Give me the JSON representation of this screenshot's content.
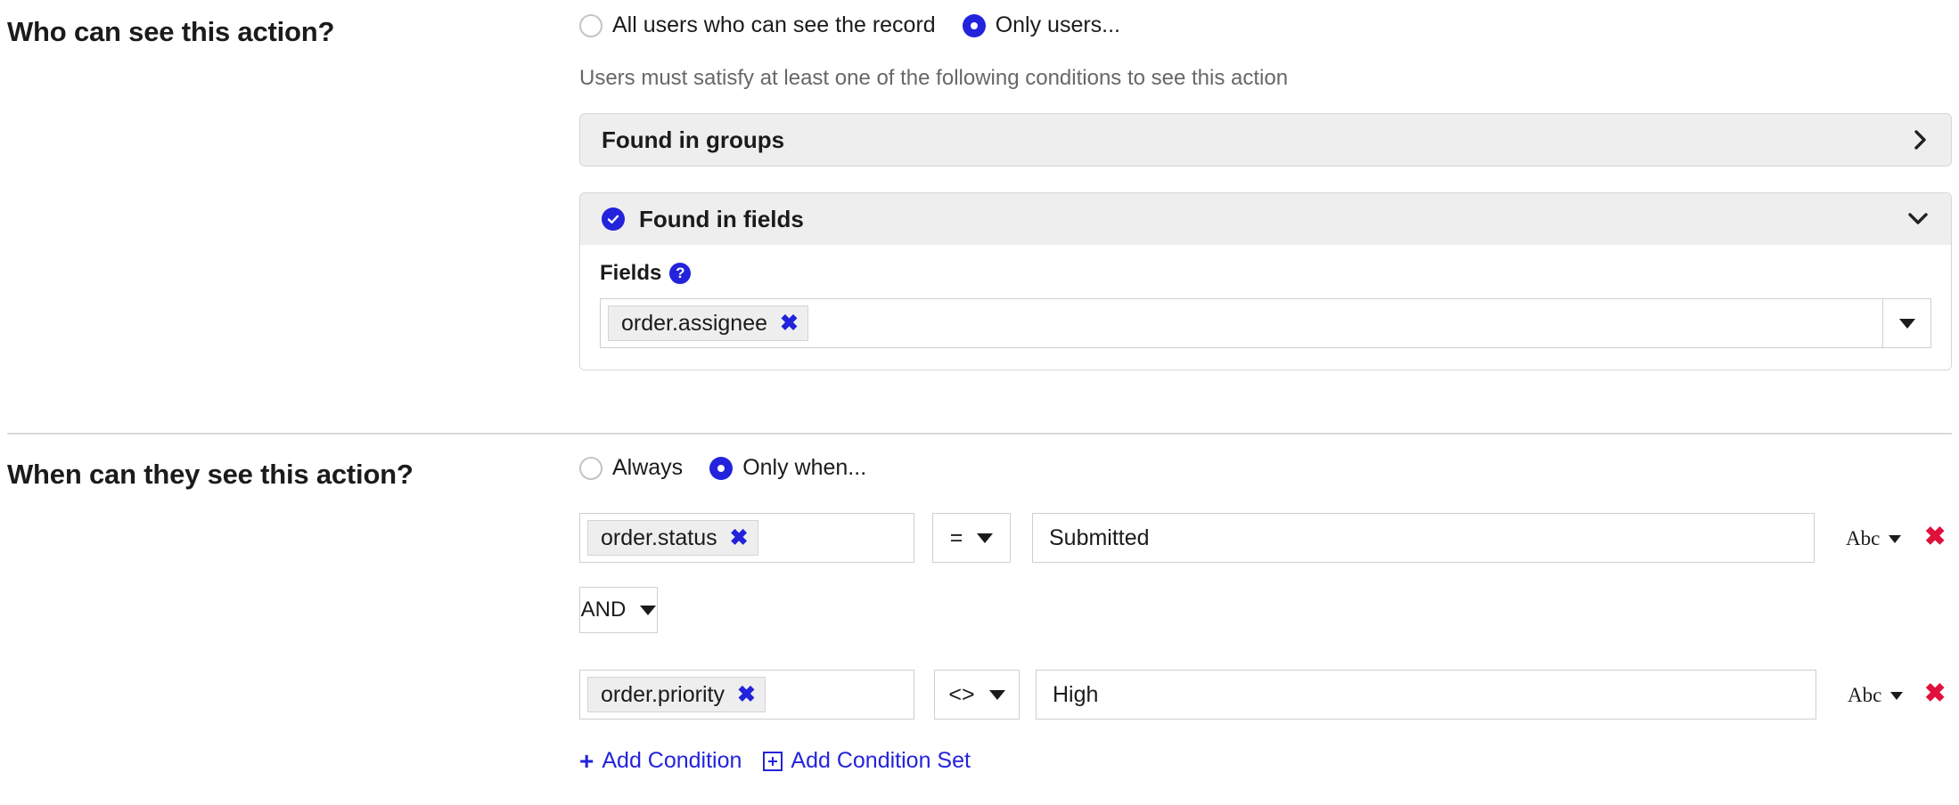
{
  "visibility_section": {
    "title": "Who can see this action?",
    "radios": [
      {
        "label": "All users who can see the record",
        "selected": false
      },
      {
        "label": "Only users...",
        "selected": true
      }
    ],
    "helper_text": "Users must satisfy at least one of the following conditions to see this action",
    "panels": [
      {
        "title": "Found in groups",
        "expanded": false,
        "checked": false,
        "chevron": "chevron-right-icon"
      },
      {
        "title": "Found in fields",
        "expanded": true,
        "checked": true,
        "chevron": "chevron-down-icon"
      }
    ],
    "fields_block": {
      "label": "Fields",
      "help_icon": "help-circle-icon",
      "tokens": [
        {
          "text": "order.assignee",
          "remove": "✖"
        }
      ],
      "dropdown_icon": "caret-down-icon"
    }
  },
  "timing_section": {
    "title": "When can they see this action?",
    "radios": [
      {
        "label": "Always",
        "selected": false
      },
      {
        "label": "Only when...",
        "selected": true
      }
    ],
    "conditions": [
      {
        "field": "order.status",
        "field_remove": "✖",
        "operator": "=",
        "value": "Submitted",
        "type_label": "Abc",
        "delete": "✖"
      },
      {
        "field": "order.priority",
        "field_remove": "✖",
        "operator": "<>",
        "value": "High",
        "type_label": "Abc",
        "delete": "✖"
      }
    ],
    "logic_operator": "AND",
    "add_condition": {
      "icon": "plus-icon",
      "label": "Add Condition"
    },
    "add_condition_set": {
      "icon": "box-plus-icon",
      "label": "Add Condition Set"
    }
  },
  "colors": {
    "accent_blue": "#2323dc",
    "delete_red": "#e0113c",
    "panel_header_gray": "#eeeeee",
    "border_gray": "#cfcfcf",
    "helper_gray": "#676767"
  }
}
